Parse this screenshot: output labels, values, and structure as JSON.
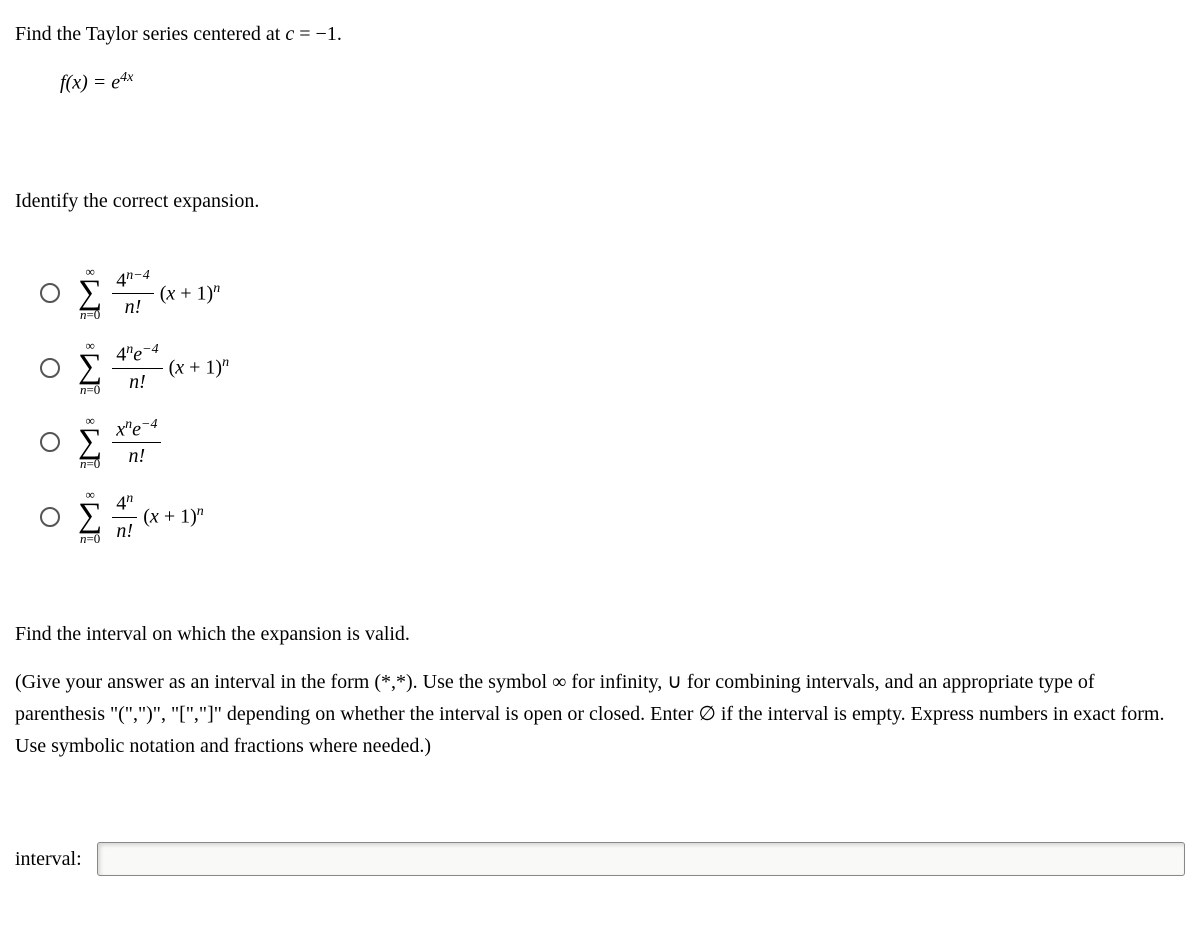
{
  "question": {
    "prompt_prefix": "Find the Taylor series centered at ",
    "prompt_var": "c",
    "prompt_eq": " = −1.",
    "function_lhs": "f(x) = ",
    "function_base": "e",
    "function_exp": "4x"
  },
  "identify": "Identify the correct expansion.",
  "sigma": {
    "top": "∞",
    "bottom_var": "n",
    "bottom_eq": "=0"
  },
  "options": [
    {
      "num_base": "4",
      "num_exp": "n−4",
      "num_extra_base": "",
      "num_extra_exp": "",
      "den": "n!",
      "term_open": "(",
      "term_var": "x",
      "term_plus": " + 1)",
      "term_exp": "n"
    },
    {
      "num_base": "4",
      "num_exp": "n",
      "num_extra_base": "e",
      "num_extra_exp": "−4",
      "den": "n!",
      "term_open": "(",
      "term_var": "x",
      "term_plus": " + 1)",
      "term_exp": "n"
    },
    {
      "num_base": "x",
      "num_exp": "n",
      "num_extra_base": "e",
      "num_extra_exp": "−4",
      "den": "n!",
      "term_open": "",
      "term_var": "",
      "term_plus": "",
      "term_exp": ""
    },
    {
      "num_base": "4",
      "num_exp": "n",
      "num_extra_base": "",
      "num_extra_exp": "",
      "den": "n!",
      "term_open": "(",
      "term_var": "x",
      "term_plus": " + 1)",
      "term_exp": "n"
    }
  ],
  "find_interval": "Find the interval on which the expansion is valid.",
  "instructions_line1": "(Give your answer as an interval in the form (*,*). Use the symbol ∞ for infinity, ∪ for combining intervals, and an appropriate",
  "instructions_line2_a": "type of parenthesis \"(\",\")\", \"[\",\"]\" depending on whether the interval is open or closed. Enter ",
  "instructions_emptyset": "∅",
  "instructions_line2_b": " if the interval is empty. Express",
  "instructions_line3": "numbers in exact form. Use symbolic notation and fractions where needed.)",
  "answer_label": "interval:",
  "answer_value": ""
}
